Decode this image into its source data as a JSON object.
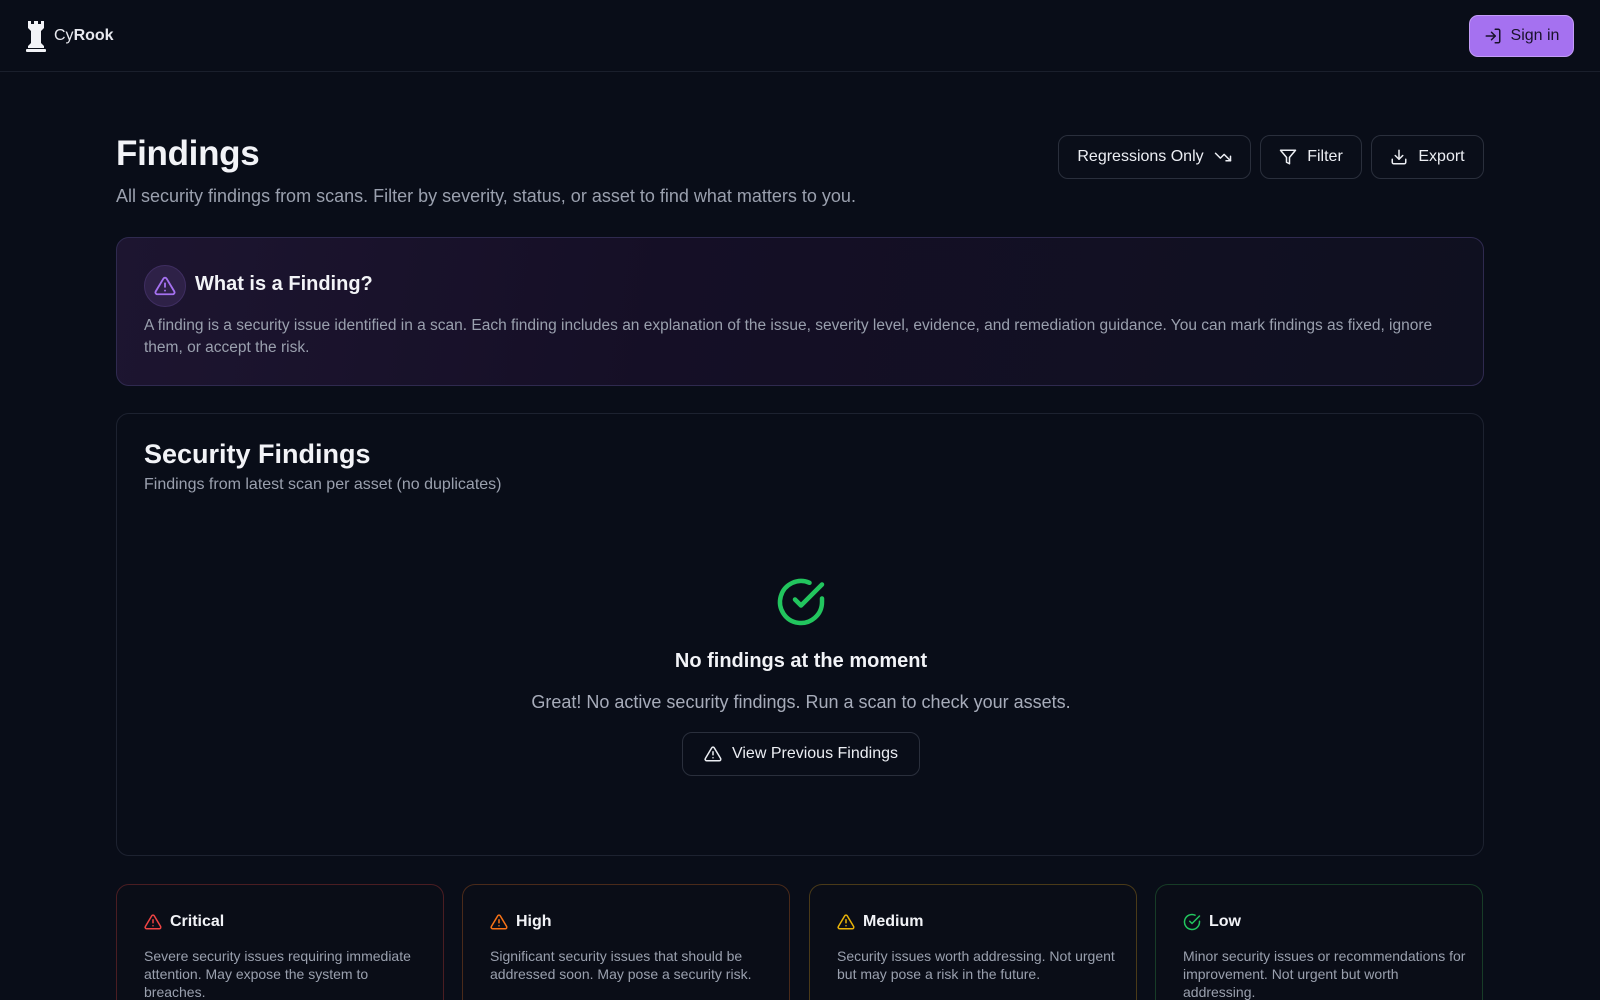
{
  "app": {
    "brand_prefix": "Cy",
    "brand_bold": "Rook"
  },
  "header": {
    "signin_label": "Sign in"
  },
  "page": {
    "title": "Findings",
    "subtitle": "All security findings from scans. Filter by severity, status, or asset to find what matters to you."
  },
  "toolbar": {
    "regressions_label": "Regressions Only",
    "filter_label": "Filter",
    "export_label": "Export"
  },
  "info": {
    "title": "What is a Finding?",
    "body": "A finding is a security issue identified in a scan. Each finding includes an explanation of the issue, severity level, evidence, and remediation guidance. You can mark findings as fixed, ignore them, or accept the risk."
  },
  "findings": {
    "title": "Security Findings",
    "subtitle": "Findings from latest scan per asset (no duplicates)",
    "empty_title": "No findings at the moment",
    "empty_text": "Great! No active security findings. Run a scan to check your assets.",
    "view_previous_label": "View Previous Findings"
  },
  "severities": [
    {
      "name": "Critical",
      "color": "#ef4444",
      "description": "Severe security issues requiring immediate attention. May expose the system to breaches."
    },
    {
      "name": "High",
      "color": "#f97316",
      "description": "Significant security issues that should be addressed soon. May pose a security risk."
    },
    {
      "name": "Medium",
      "color": "#eab308",
      "description": "Security issues worth addressing. Not urgent but may pose a risk in the future."
    },
    {
      "name": "Low",
      "color": "#22c55e",
      "description": "Minor security issues or recommendations for improvement. Not urgent but worth addressing."
    }
  ],
  "colors": {
    "accent": "#a571f0",
    "background": "#090d18",
    "success": "#22c55e"
  },
  "icons": {
    "logo": "rook-chess-icon",
    "signin": "sign-in-icon",
    "regressions": "trending-down-icon",
    "filter": "filter-icon",
    "export": "download-icon",
    "info": "warning-triangle-icon",
    "empty": "check-circle-icon",
    "view_previous": "warning-triangle-icon"
  }
}
